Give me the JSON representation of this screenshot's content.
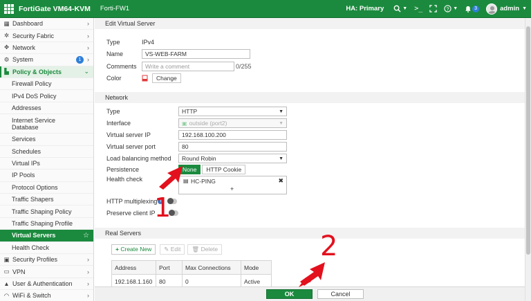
{
  "topbar": {
    "product": "FortiGate VM64-KVM",
    "device": "Forti-FW1",
    "ha_status": "HA: Primary",
    "terminal_glyph": ">_",
    "notification_count": "3",
    "user": "admin"
  },
  "sidebar": {
    "items": [
      {
        "icon": "▦",
        "label": "Dashboard",
        "chevron": "›"
      },
      {
        "icon": "✲",
        "label": "Security Fabric",
        "chevron": "›"
      },
      {
        "icon": "✥",
        "label": "Network",
        "chevron": "›"
      },
      {
        "icon": "⚙",
        "label": "System",
        "badge": "1",
        "chevron": "›"
      },
      {
        "icon": "▙",
        "label": "Policy & Objects",
        "chevron": "⌄"
      }
    ],
    "sub_items": [
      "Firewall Policy",
      "IPv4 DoS Policy",
      "Addresses",
      "Internet Service Database",
      "Services",
      "Schedules",
      "Virtual IPs",
      "IP Pools",
      "Protocol Options",
      "Traffic Shapers",
      "Traffic Shaping Policy",
      "Traffic Shaping Profile",
      "Virtual Servers",
      "Health Check"
    ],
    "bottom_items": [
      {
        "icon": "▣",
        "label": "Security Profiles",
        "chevron": "›"
      },
      {
        "icon": "▭",
        "label": "VPN",
        "chevron": "›"
      },
      {
        "icon": "▲",
        "label": "User & Authentication",
        "chevron": "›"
      },
      {
        "icon": "◠",
        "label": "WiFi & Switch",
        "chevron": "›"
      }
    ]
  },
  "form": {
    "section_title": "Edit Virtual Server",
    "type_label": "Type",
    "type_value": "IPv4",
    "name_label": "Name",
    "name_value": "VS-WEB-FARM",
    "comments_label": "Comments",
    "comments_placeholder": "Write a comment",
    "comments_counter": "0/255",
    "color_label": "Color",
    "color_change": "Change"
  },
  "network": {
    "section_title": "Network",
    "type_label": "Type",
    "type_value": "HTTP",
    "interface_label": "Interface",
    "interface_value": "outside (port2)",
    "vip_label": "Virtual server IP",
    "vip_value": "192.168.100.200",
    "port_label": "Virtual server port",
    "port_value": "80",
    "lb_label": "Load balancing method",
    "lb_value": "Round Robin",
    "persistence_label": "Persistence",
    "persistence_options": [
      "None",
      "HTTP Cookie"
    ],
    "health_label": "Health check",
    "health_item": "HC-PING",
    "health_add": "+",
    "health_remove": "✖",
    "http_mux_label": "HTTP multiplexing",
    "preserve_ip_label": "Preserve client IP"
  },
  "real_servers": {
    "section_title": "Real Servers",
    "create_new": "Create New",
    "edit": "Edit",
    "delete": "Delete",
    "columns": [
      "Address",
      "Port",
      "Max Connections",
      "Mode"
    ],
    "rows": [
      [
        "192.168.1.160",
        "80",
        "0",
        "Active"
      ]
    ]
  },
  "footer": {
    "ok": "OK",
    "cancel": "Cancel"
  },
  "annotations": {
    "step1": "1",
    "step2": "2"
  },
  "colors": {
    "brand_green": "#1b8a3e",
    "annotation_red": "#e3101d"
  }
}
